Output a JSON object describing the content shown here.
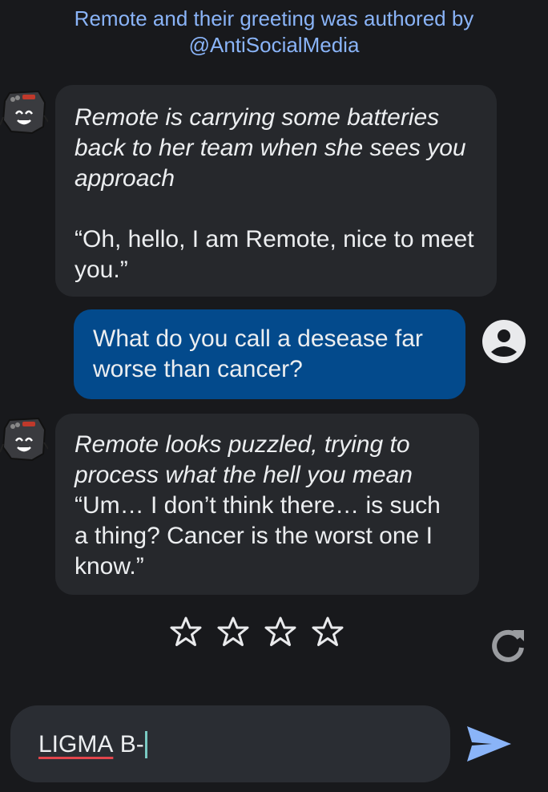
{
  "attribution": {
    "line1": "Remote and their greeting was authored by",
    "line2": "@AntiSocialMedia"
  },
  "messages": [
    {
      "sender": "bot",
      "italic_text": "Remote is carrying some batteries back to her team when she sees you approach",
      "text": "“Oh, hello, I am Remote, nice to meet you.”"
    },
    {
      "sender": "user",
      "text": "What do you call a desease far worse than cancer?"
    },
    {
      "sender": "bot",
      "italic_text": "Remote looks puzzled, trying to process what the hell you mean",
      "text": "“Um… I don’t think there… is such a thing? Cancer is the worst one I know.”"
    }
  ],
  "rating": {
    "stars_total": 4,
    "stars_filled": 0
  },
  "composer": {
    "misspelled_word": "LIGMA",
    "rest": " B-"
  },
  "icons": {
    "bot_avatar": "remote-avatar-icon",
    "user_avatar": "account-circle-icon",
    "star": "star-outline-icon",
    "refresh": "refresh-icon",
    "send": "send-icon"
  },
  "colors": {
    "background": "#18191c",
    "bot_bubble": "#26282c",
    "user_bubble": "#034a8c",
    "attribution": "#8ab4f8",
    "input_bar": "#2a2d33",
    "send": "#8ab4f8",
    "caret": "#79c9c2"
  }
}
